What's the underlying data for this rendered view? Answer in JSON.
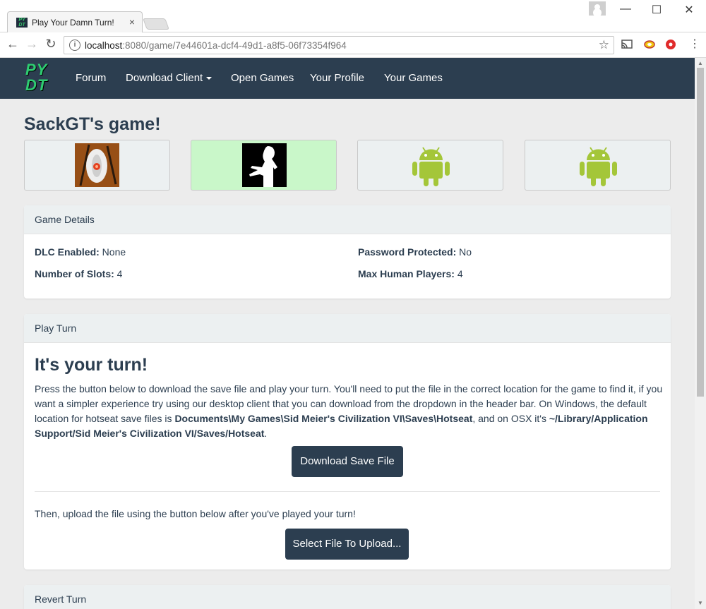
{
  "browser": {
    "tab_title": "Play Your Damn Turn!",
    "tab_close": "×",
    "url_host": "localhost",
    "url_rest": ":8080/game/7e44601a-dcf4-49d1-a8f5-06f73354f964",
    "info_icon": "i"
  },
  "nav": {
    "logo_line1": "PY",
    "logo_line2": "DT",
    "forum": "Forum",
    "download_client": "Download Client",
    "open_games": "Open Games",
    "your_profile": "Your Profile",
    "your_games": "Your Games"
  },
  "page": {
    "title": "SackGT's game!"
  },
  "players": [
    {
      "avatar": "portal-turret-avatar",
      "active": false
    },
    {
      "avatar": "soldier-silhouette-avatar",
      "active": true
    },
    {
      "avatar": "android-avatar",
      "active": false
    },
    {
      "avatar": "android-avatar",
      "active": false
    }
  ],
  "game_details": {
    "heading": "Game Details",
    "dlc_label": "DLC Enabled:",
    "dlc_value": "None",
    "slots_label": "Number of Slots:",
    "slots_value": "4",
    "password_label": "Password Protected:",
    "password_value": "No",
    "max_human_label": "Max Human Players:",
    "max_human_value": "4"
  },
  "play_turn": {
    "heading": "Play Turn",
    "turn_title": "It's your turn!",
    "text_1": "Press the button below to download the save file and play your turn. You'll need to put the file in the correct location for the game to find it, if you want a simpler experience try using our desktop client that you can download from the dropdown in the header bar. On Windows, the default location for hotseat save files is ",
    "windows_path": "Documents\\My Games\\Sid Meier's Civilization VI\\Saves\\Hotseat",
    "text_2": ", and on OSX it's ",
    "osx_path": "~/Library/Application Support/Sid Meier's Civilization VI/Saves/Hotseat",
    "text_3": ".",
    "download_button": "Download Save File",
    "upload_text": "Then, upload the file using the button below after you've played your turn!",
    "upload_button": "Select File To Upload..."
  },
  "revert_turn": {
    "heading": "Revert Turn"
  },
  "colors": {
    "navbar": "#2c3e50",
    "logo_green": "#2ecc71",
    "active_player": "#c9f7c9",
    "android_green": "#a4c639"
  }
}
